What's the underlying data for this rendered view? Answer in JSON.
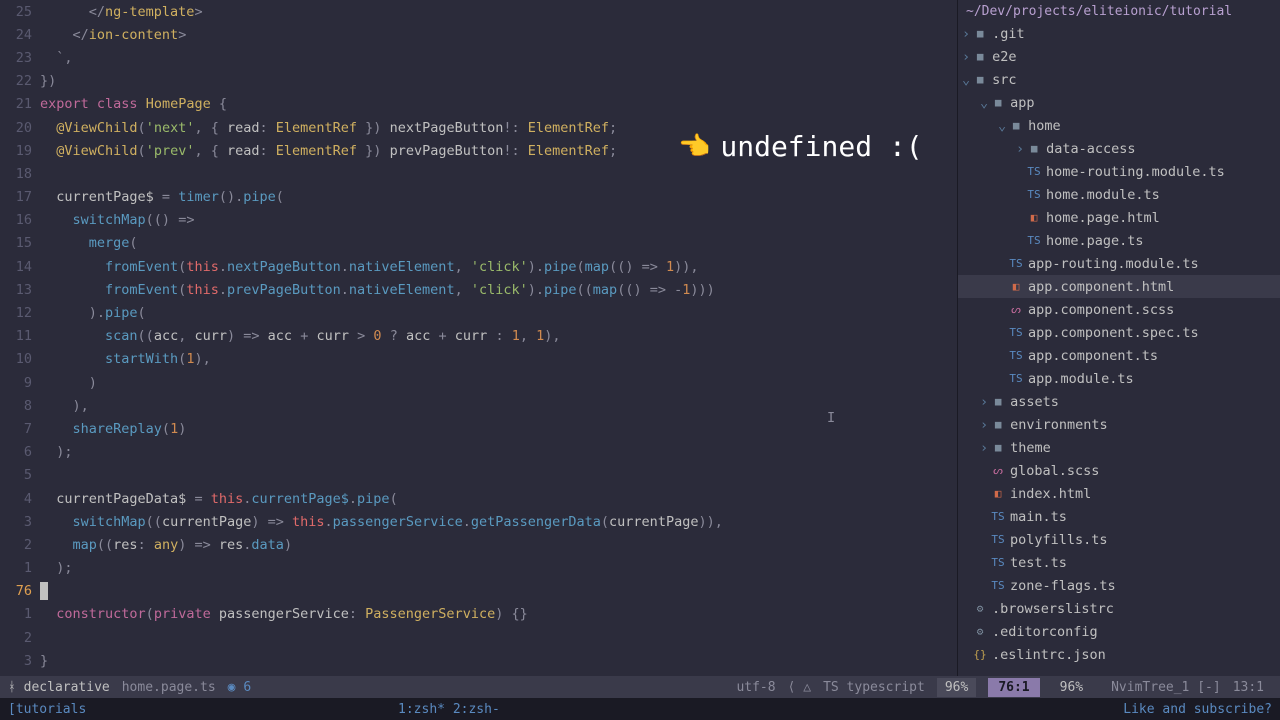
{
  "sidebar": {
    "path": "~/Dev/projects/eliteionic/tutorial",
    "items": [
      {
        "depth": 0,
        "chev": ">",
        "icon": "folder",
        "label": ".git"
      },
      {
        "depth": 0,
        "chev": ">",
        "icon": "folder",
        "label": "e2e"
      },
      {
        "depth": 0,
        "chev": "v",
        "icon": "folder",
        "label": "src"
      },
      {
        "depth": 1,
        "chev": "v",
        "icon": "folder",
        "label": "app"
      },
      {
        "depth": 2,
        "chev": "v",
        "icon": "folder",
        "label": "home"
      },
      {
        "depth": 3,
        "chev": ">",
        "icon": "folder",
        "label": "data-access"
      },
      {
        "depth": 3,
        "icon": "ts",
        "label": "home-routing.module.ts"
      },
      {
        "depth": 3,
        "icon": "ts",
        "label": "home.module.ts"
      },
      {
        "depth": 3,
        "icon": "html",
        "label": "home.page.html"
      },
      {
        "depth": 3,
        "icon": "ts",
        "label": "home.page.ts"
      },
      {
        "depth": 2,
        "icon": "ts",
        "label": "app-routing.module.ts"
      },
      {
        "depth": 2,
        "icon": "html",
        "label": "app.component.html",
        "selected": true
      },
      {
        "depth": 2,
        "icon": "scss",
        "label": "app.component.scss"
      },
      {
        "depth": 2,
        "icon": "ts",
        "label": "app.component.spec.ts"
      },
      {
        "depth": 2,
        "icon": "ts",
        "label": "app.component.ts"
      },
      {
        "depth": 2,
        "icon": "ts",
        "label": "app.module.ts"
      },
      {
        "depth": 1,
        "chev": ">",
        "icon": "folder",
        "label": "assets"
      },
      {
        "depth": 1,
        "chev": ">",
        "icon": "folder",
        "label": "environments"
      },
      {
        "depth": 1,
        "chev": ">",
        "icon": "folder",
        "label": "theme"
      },
      {
        "depth": 1,
        "icon": "scss",
        "label": "global.scss"
      },
      {
        "depth": 1,
        "icon": "html",
        "label": "index.html"
      },
      {
        "depth": 1,
        "icon": "ts",
        "label": "main.ts"
      },
      {
        "depth": 1,
        "icon": "ts",
        "label": "polyfills.ts"
      },
      {
        "depth": 1,
        "icon": "ts",
        "label": "test.ts"
      },
      {
        "depth": 1,
        "icon": "ts",
        "label": "zone-flags.ts"
      },
      {
        "depth": 0,
        "icon": "config",
        "label": ".browserslistrc"
      },
      {
        "depth": 0,
        "icon": "config",
        "label": ".editorconfig"
      },
      {
        "depth": 0,
        "icon": "json",
        "label": ".eslintrc.json"
      }
    ]
  },
  "callout": {
    "text": "undefined :("
  },
  "code": [
    {
      "n": "25",
      "tokens": [
        [
          "punc",
          "      </"
        ],
        [
          "type",
          "ng-template"
        ],
        [
          "punc",
          ">"
        ]
      ]
    },
    {
      "n": "24",
      "tokens": [
        [
          "punc",
          "    </"
        ],
        [
          "type",
          "ion-content"
        ],
        [
          "punc",
          ">"
        ]
      ]
    },
    {
      "n": "23",
      "tokens": [
        [
          "punc",
          "  `"
        ],
        [
          "punc",
          ","
        ]
      ]
    },
    {
      "n": "22",
      "tokens": [
        [
          "punc",
          "})"
        ]
      ]
    },
    {
      "n": "21",
      "tokens": [
        [
          "kw",
          "export "
        ],
        [
          "kw",
          "class "
        ],
        [
          "type",
          "HomePage"
        ],
        [
          "punc",
          " {"
        ]
      ]
    },
    {
      "n": "20",
      "tokens": [
        [
          "decor",
          "  @ViewChild"
        ],
        [
          "punc",
          "("
        ],
        [
          "str",
          "'next'"
        ],
        [
          "punc",
          ", { "
        ],
        [
          "prop",
          "read"
        ],
        [
          "punc",
          ": "
        ],
        [
          "type",
          "ElementRef"
        ],
        [
          "punc",
          " }) "
        ],
        [
          "prop",
          "nextPageButton"
        ],
        [
          "punc",
          "!: "
        ],
        [
          "type",
          "ElementRef"
        ],
        [
          "punc",
          ";"
        ]
      ]
    },
    {
      "n": "19",
      "tokens": [
        [
          "decor",
          "  @ViewChild"
        ],
        [
          "punc",
          "("
        ],
        [
          "str",
          "'prev'"
        ],
        [
          "punc",
          ", { "
        ],
        [
          "prop",
          "read"
        ],
        [
          "punc",
          ": "
        ],
        [
          "type",
          "ElementRef"
        ],
        [
          "punc",
          " }) "
        ],
        [
          "prop",
          "prevPageButton"
        ],
        [
          "punc",
          "!: "
        ],
        [
          "type",
          "ElementRef"
        ],
        [
          "punc",
          ";"
        ]
      ]
    },
    {
      "n": "18",
      "tokens": []
    },
    {
      "n": "17",
      "tokens": [
        [
          "prop",
          "  currentPage$"
        ],
        [
          "punc",
          " = "
        ],
        [
          "fn",
          "timer"
        ],
        [
          "punc",
          "()."
        ],
        [
          "fn",
          "pipe"
        ],
        [
          "punc",
          "("
        ]
      ]
    },
    {
      "n": "16",
      "tokens": [
        [
          "fn",
          "    switchMap"
        ],
        [
          "punc",
          "(() "
        ],
        [
          "op",
          "=>"
        ]
      ]
    },
    {
      "n": "15",
      "tokens": [
        [
          "fn",
          "      merge"
        ],
        [
          "punc",
          "("
        ]
      ]
    },
    {
      "n": "14",
      "tokens": [
        [
          "fn",
          "        fromEvent"
        ],
        [
          "punc",
          "("
        ],
        [
          "var",
          "this"
        ],
        [
          "punc",
          "."
        ],
        [
          "member",
          "nextPageButton"
        ],
        [
          "punc",
          "."
        ],
        [
          "member",
          "nativeElement"
        ],
        [
          "punc",
          ", "
        ],
        [
          "str",
          "'click'"
        ],
        [
          "punc",
          ")."
        ],
        [
          "fn",
          "pipe"
        ],
        [
          "punc",
          "("
        ],
        [
          "fn",
          "map"
        ],
        [
          "punc",
          "(() "
        ],
        [
          "op",
          "=>"
        ],
        [
          "punc",
          " "
        ],
        [
          "num",
          "1"
        ],
        [
          "punc",
          ")),"
        ]
      ]
    },
    {
      "n": "13",
      "tokens": [
        [
          "fn",
          "        fromEvent"
        ],
        [
          "punc",
          "("
        ],
        [
          "var",
          "this"
        ],
        [
          "punc",
          "."
        ],
        [
          "member",
          "prevPageButton"
        ],
        [
          "punc",
          "."
        ],
        [
          "member",
          "nativeElement"
        ],
        [
          "punc",
          ", "
        ],
        [
          "str",
          "'click'"
        ],
        [
          "punc",
          ")."
        ],
        [
          "fn",
          "pipe"
        ],
        [
          "punc",
          "(("
        ],
        [
          "fn",
          "map"
        ],
        [
          "punc",
          "(() "
        ],
        [
          "op",
          "=>"
        ],
        [
          "punc",
          " "
        ],
        [
          "op",
          "-"
        ],
        [
          "num",
          "1"
        ],
        [
          "punc",
          ")))"
        ]
      ]
    },
    {
      "n": "12",
      "tokens": [
        [
          "punc",
          "      )."
        ],
        [
          "fn",
          "pipe"
        ],
        [
          "punc",
          "("
        ]
      ]
    },
    {
      "n": "11",
      "tokens": [
        [
          "fn",
          "        scan"
        ],
        [
          "punc",
          "(("
        ],
        [
          "param",
          "acc"
        ],
        [
          "punc",
          ", "
        ],
        [
          "param",
          "curr"
        ],
        [
          "punc",
          ") "
        ],
        [
          "op",
          "=>"
        ],
        [
          "punc",
          " "
        ],
        [
          "param",
          "acc"
        ],
        [
          "punc",
          " "
        ],
        [
          "op",
          "+"
        ],
        [
          "punc",
          " "
        ],
        [
          "param",
          "curr"
        ],
        [
          "punc",
          " "
        ],
        [
          "op",
          ">"
        ],
        [
          "punc",
          " "
        ],
        [
          "num",
          "0"
        ],
        [
          "punc",
          " "
        ],
        [
          "op",
          "?"
        ],
        [
          "punc",
          " "
        ],
        [
          "param",
          "acc"
        ],
        [
          "punc",
          " "
        ],
        [
          "op",
          "+"
        ],
        [
          "punc",
          " "
        ],
        [
          "param",
          "curr"
        ],
        [
          "punc",
          " "
        ],
        [
          "op",
          ":"
        ],
        [
          "punc",
          " "
        ],
        [
          "num",
          "1"
        ],
        [
          "punc",
          ", "
        ],
        [
          "num",
          "1"
        ],
        [
          "punc",
          "),"
        ]
      ]
    },
    {
      "n": "10",
      "tokens": [
        [
          "fn",
          "        startWith"
        ],
        [
          "punc",
          "("
        ],
        [
          "num",
          "1"
        ],
        [
          "punc",
          "),"
        ]
      ]
    },
    {
      "n": "9",
      "tokens": [
        [
          "punc",
          "      )"
        ]
      ]
    },
    {
      "n": "8",
      "tokens": [
        [
          "punc",
          "    ),"
        ]
      ]
    },
    {
      "n": "7",
      "tokens": [
        [
          "fn",
          "    shareReplay"
        ],
        [
          "punc",
          "("
        ],
        [
          "num",
          "1"
        ],
        [
          "punc",
          ")"
        ]
      ]
    },
    {
      "n": "6",
      "tokens": [
        [
          "punc",
          "  );"
        ]
      ]
    },
    {
      "n": "5",
      "tokens": []
    },
    {
      "n": "4",
      "tokens": [
        [
          "prop",
          "  currentPageData$"
        ],
        [
          "punc",
          " = "
        ],
        [
          "var",
          "this"
        ],
        [
          "punc",
          "."
        ],
        [
          "member",
          "currentPage$"
        ],
        [
          "punc",
          "."
        ],
        [
          "fn",
          "pipe"
        ],
        [
          "punc",
          "("
        ]
      ]
    },
    {
      "n": "3",
      "tokens": [
        [
          "fn",
          "    switchMap"
        ],
        [
          "punc",
          "(("
        ],
        [
          "param",
          "currentPage"
        ],
        [
          "punc",
          ") "
        ],
        [
          "op",
          "=>"
        ],
        [
          "punc",
          " "
        ],
        [
          "var",
          "this"
        ],
        [
          "punc",
          "."
        ],
        [
          "member",
          "passengerService"
        ],
        [
          "punc",
          "."
        ],
        [
          "fn",
          "getPassengerData"
        ],
        [
          "punc",
          "("
        ],
        [
          "param",
          "currentPage"
        ],
        [
          "punc",
          ")),"
        ]
      ]
    },
    {
      "n": "2",
      "tokens": [
        [
          "fn",
          "    map"
        ],
        [
          "punc",
          "(("
        ],
        [
          "param",
          "res"
        ],
        [
          "punc",
          ": "
        ],
        [
          "type",
          "any"
        ],
        [
          "punc",
          ") "
        ],
        [
          "op",
          "=>"
        ],
        [
          "punc",
          " "
        ],
        [
          "param",
          "res"
        ],
        [
          "punc",
          "."
        ],
        [
          "member",
          "data"
        ],
        [
          "punc",
          ")"
        ]
      ]
    },
    {
      "n": "1",
      "tokens": [
        [
          "punc",
          "  );"
        ]
      ]
    },
    {
      "n": "76",
      "current": true,
      "tokens": [
        [
          "cursor",
          ""
        ]
      ]
    },
    {
      "n": "1",
      "tokens": [
        [
          "kw",
          "  constructor"
        ],
        [
          "punc",
          "("
        ],
        [
          "kw",
          "private "
        ],
        [
          "param",
          "passengerService"
        ],
        [
          "punc",
          ": "
        ],
        [
          "type",
          "PassengerService"
        ],
        [
          "punc",
          ") {}"
        ]
      ]
    },
    {
      "n": "2",
      "tokens": []
    },
    {
      "n": "3",
      "tokens": [
        [
          "punc",
          "}"
        ]
      ]
    }
  ],
  "statusline": {
    "branch_icon": "ᚼ",
    "branch": "declarative",
    "file": "home.page.ts",
    "mod_icon": "◉",
    "mod_count": "6",
    "encoding": "utf-8",
    "sep": "⎇",
    "ft_icon": "TS",
    "filetype": "typescript",
    "percent1": "96%",
    "pos": "76:1",
    "percent2": "96%",
    "tree": "NvimTree_1 [-]",
    "pos2": "13:1"
  },
  "tabline": {
    "left": "[tutorials",
    "center": "1:zsh* 2:zsh-",
    "right": "Like and subscribe?"
  }
}
